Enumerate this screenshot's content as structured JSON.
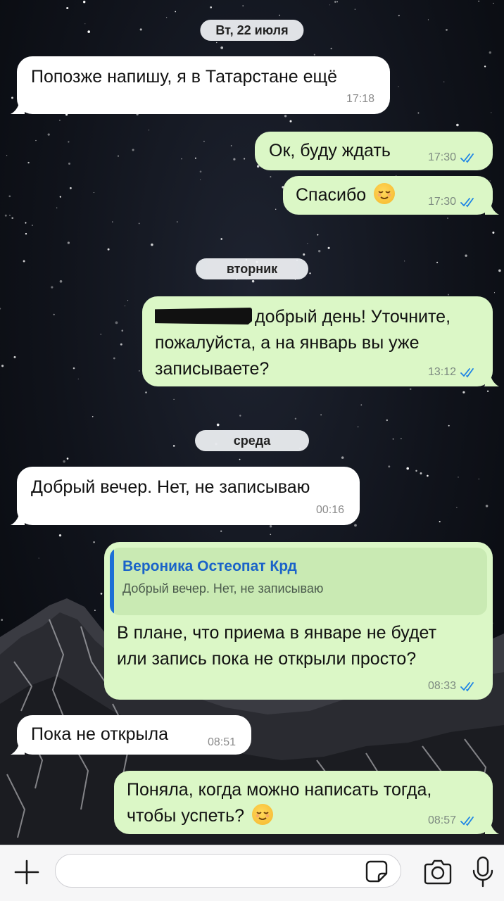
{
  "colors": {
    "incoming_bubble": "#ffffff",
    "outgoing_bubble": "#dbf7c6",
    "read_check": "#1d84e6",
    "quote_accent": "#1a63c9"
  },
  "dates": [
    "Вт, 22 июля",
    "вторник",
    "среда"
  ],
  "messages": [
    {
      "dir": "in",
      "text": "Попозже напишу, я в Татарстане ещё",
      "time": "17:18"
    },
    {
      "dir": "out",
      "text": "Ок, буду ждать",
      "time": "17:30",
      "status": "read"
    },
    {
      "dir": "out",
      "text": "Спасибо",
      "emoji": "relieved-face",
      "time": "17:30",
      "status": "read"
    },
    {
      "dir": "out",
      "text_line1": "добрый день! Уточните,",
      "text_line2": "пожалуйста, а на январь вы уже",
      "text_line3": "записываете?",
      "redacted": true,
      "time": "13:12",
      "status": "read"
    },
    {
      "dir": "in",
      "text": "Добрый вечер. Нет, не записываю",
      "time": "00:16"
    },
    {
      "dir": "out",
      "quote_author": "Вероника Остеопат Крд",
      "quote_text": "Добрый вечер. Нет, не записываю",
      "text_line1": "В плане, что приема в январе не будет",
      "text_line2": "или запись пока не открыли просто?",
      "time": "08:33",
      "status": "read"
    },
    {
      "dir": "in",
      "text": "Пока не открыла",
      "time": "08:51"
    },
    {
      "dir": "out",
      "text_line1": "Поняла, когда можно написать тогда,",
      "text_line2": "чтобы успеть?",
      "emoji": "relieved-face",
      "time": "08:57",
      "status": "read"
    }
  ],
  "input_bar": {
    "placeholder": "",
    "icons": [
      "plus-icon",
      "sticker-icon",
      "camera-icon",
      "microphone-icon"
    ]
  }
}
